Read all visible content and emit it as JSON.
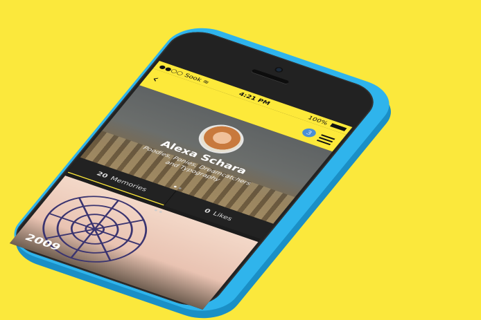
{
  "status_bar": {
    "carrier": "●●○○ Sook",
    "wifi_icon": "wifi-icon",
    "time": "4:21 PM",
    "battery": "100%"
  },
  "nav": {
    "back_icon": "chevron-left-icon",
    "notification_count": "3",
    "menu_icon": "hamburger-icon"
  },
  "profile": {
    "name": "Alexa Schara",
    "tagline": "Poodles, Ponies, Dreamcatchers and Typography"
  },
  "tabs": [
    {
      "count": "20",
      "label": "Memories",
      "active": true
    },
    {
      "count": "0",
      "label": "Likes",
      "active": false
    }
  ],
  "feed": {
    "year": "2009"
  },
  "colors": {
    "background": "#fbe83c",
    "accent": "#fde93a",
    "phone_shell": "#2fb4ec",
    "badge": "#4a8fd6"
  }
}
